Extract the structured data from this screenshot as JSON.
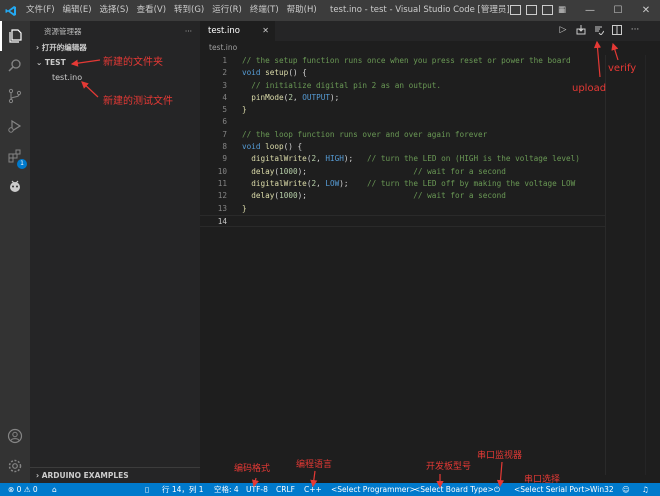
{
  "titlebar": {
    "menu": [
      "文件(F)",
      "编辑(E)",
      "选择(S)",
      "查看(V)",
      "转到(G)",
      "运行(R)",
      "终端(T)",
      "帮助(H)"
    ],
    "title": "test.ino - test - Visual Studio Code [管理员]",
    "accent": "#007acc"
  },
  "activity": {
    "icons": [
      "explorer-icon",
      "search-icon",
      "source-control-icon",
      "run-debug-icon",
      "extensions-icon",
      "arduino-icon",
      "account-icon",
      "settings-gear-icon"
    ],
    "extensions_badge": "1"
  },
  "sidebar": {
    "header": "资源管理器",
    "more": "···",
    "open_editors": "打开的编辑器",
    "folder": "TEST",
    "files": [
      "test.ino"
    ],
    "bottom_section": "ARDUINO EXAMPLES"
  },
  "editor": {
    "tab": "test.ino",
    "breadcrumb": "test.ino",
    "lines": [
      "// the setup function runs once when you press reset or power the board",
      "void setup() {",
      "  // initialize digital pin 2 as an output.",
      "  pinMode(2, OUTPUT);",
      "}",
      "",
      "// the loop function runs over and over again forever",
      "void loop() {",
      "  digitalWrite(2, HIGH);   // turn the LED on (HIGH is the voltage level)",
      "  delay(1000);                       // wait for a second",
      "  digitalWrite(2, LOW);    // turn the LED off by making the voltage LOW",
      "  delay(1000);                       // wait for a second",
      "}",
      ""
    ],
    "line_numbers": [
      "1",
      "2",
      "3",
      "4",
      "5",
      "6",
      "7",
      "8",
      "9",
      "10",
      "11",
      "12",
      "13",
      "14"
    ]
  },
  "statusbar": {
    "errors": "⊗ 0 ⚠ 0",
    "cursor": "行 14，列 1",
    "spaces": "空格: 4",
    "encoding": "UTF-8",
    "eol": "CRLF",
    "language": "C++",
    "programmer": "<Select Programmer>",
    "board": "<Select Board Type>",
    "serial_port": "<Select Serial Port>",
    "platform": "Win32"
  },
  "annotations": {
    "new_folder": "新建的文件夹",
    "new_file": "新建的测试文件",
    "upload": "upload",
    "verify": "verify",
    "encoding": "编码格式",
    "language": "编程语言",
    "board": "开发板型号",
    "serial_monitor": "串口监视器",
    "serial_select": "串口选择"
  }
}
